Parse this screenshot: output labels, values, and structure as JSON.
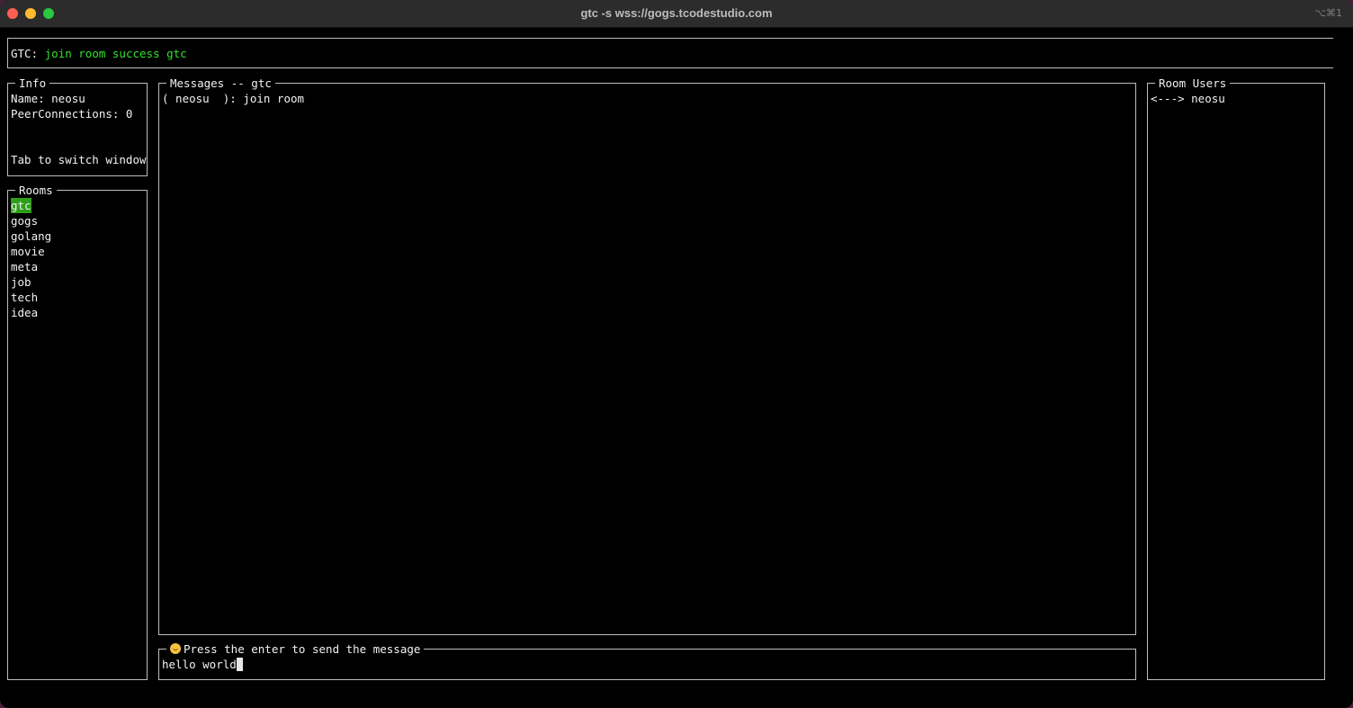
{
  "window": {
    "title": "gtc -s wss://gogs.tcodestudio.com",
    "shortcut": "⌥⌘1"
  },
  "status": {
    "prefix": "GTC:",
    "message": "join room success gtc"
  },
  "info": {
    "title": "Info",
    "name_line": "Name: neosu",
    "peer_line": "PeerConnections: 0",
    "hint": "Tab to switch window"
  },
  "rooms": {
    "title": "Rooms",
    "items": [
      "gtc",
      "gogs",
      "golang",
      "movie",
      "meta",
      "job",
      "tech",
      "idea"
    ],
    "selected_index": 0
  },
  "messages": {
    "title": "Messages -- gtc",
    "lines": [
      "( neosu  ): join room"
    ]
  },
  "input": {
    "icon": "grinning-face-icon",
    "title": "Press the enter to send the message",
    "value": "hello world"
  },
  "room_users": {
    "title": "Room Users",
    "users": [
      "<---> neosu"
    ]
  },
  "colors": {
    "accent_green": "#35e02f",
    "selected_bg": "#2f9e19"
  }
}
